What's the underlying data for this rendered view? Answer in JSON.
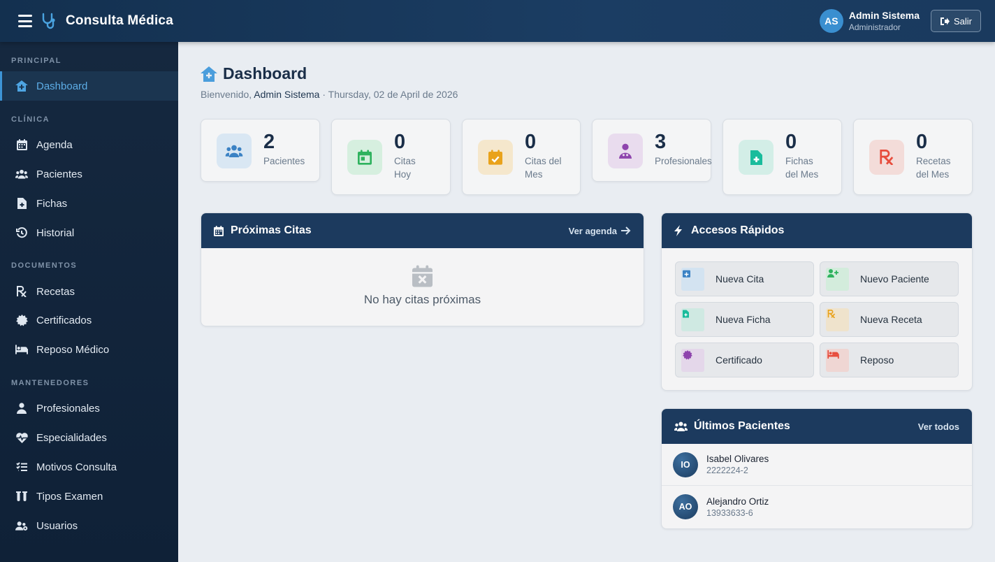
{
  "app": {
    "title": "Consulta Médica"
  },
  "user": {
    "initials": "AS",
    "name": "Admin Sistema",
    "role": "Administrador",
    "logout_label": "Salir"
  },
  "sidebar": {
    "sections": [
      {
        "title": "PRINCIPAL"
      },
      {
        "title": "CLÍNICA"
      },
      {
        "title": "DOCUMENTOS"
      },
      {
        "title": "MANTENEDORES"
      }
    ],
    "items": [
      {
        "label": "Dashboard",
        "icon": "home-medical-icon",
        "active": true
      },
      {
        "label": "Agenda",
        "icon": "calendar-icon"
      },
      {
        "label": "Pacientes",
        "icon": "users-icon"
      },
      {
        "label": "Fichas",
        "icon": "file-medical-icon"
      },
      {
        "label": "Historial",
        "icon": "history-icon"
      },
      {
        "label": "Recetas",
        "icon": "prescription-icon"
      },
      {
        "label": "Certificados",
        "icon": "certificate-icon"
      },
      {
        "label": "Reposo Médico",
        "icon": "bed-icon"
      },
      {
        "label": "Profesionales",
        "icon": "doctor-icon"
      },
      {
        "label": "Especialidades",
        "icon": "heartbeat-icon"
      },
      {
        "label": "Motivos Consulta",
        "icon": "list-check-icon"
      },
      {
        "label": "Tipos Examen",
        "icon": "vials-icon"
      },
      {
        "label": "Usuarios",
        "icon": "users-cog-icon"
      }
    ]
  },
  "page": {
    "title": "Dashboard",
    "welcome_prefix": "Bienvenido,",
    "welcome_user": "Admin Sistema",
    "welcome_date": "· Thursday, 02 de April de 2026"
  },
  "stats": [
    {
      "value": "2",
      "label_line1": "Pacientes",
      "label_line2": "",
      "color": "#3b82c4",
      "bg": "#d9e7f3"
    },
    {
      "value": "0",
      "label_line1": "Citas",
      "label_line2": "Hoy",
      "color": "#2fb25e",
      "bg": "#d6efdf"
    },
    {
      "value": "0",
      "label_line1": "Citas del",
      "label_line2": "Mes",
      "color": "#e9a21b",
      "bg": "#f5e7cc"
    },
    {
      "value": "3",
      "label_line1": "Profesionales",
      "label_line2": "",
      "color": "#8e44ad",
      "bg": "#e9dcee"
    },
    {
      "value": "0",
      "label_line1": "Fichas",
      "label_line2": "del Mes",
      "color": "#1abc9c",
      "bg": "#d3eee7"
    },
    {
      "value": "0",
      "label_line1": "Recetas",
      "label_line2": "del Mes",
      "color": "#e74c3c",
      "bg": "#f3dcd9"
    }
  ],
  "upcoming": {
    "title": "Próximas Citas",
    "link": "Ver agenda",
    "empty": "No hay citas próximas"
  },
  "quick": {
    "title": "Accesos Rápidos",
    "items": [
      {
        "label": "Nueva Cita",
        "color": "#3b82c4",
        "bg": "#d3e3f1"
      },
      {
        "label": "Nuevo Paciente",
        "color": "#2fb25e",
        "bg": "#d3ecdc"
      },
      {
        "label": "Nueva Ficha",
        "color": "#1abc9c",
        "bg": "#cfe9e2"
      },
      {
        "label": "Nueva Receta",
        "color": "#e9a21b",
        "bg": "#efe3cc"
      },
      {
        "label": "Certificado",
        "color": "#8e44ad",
        "bg": "#e4d7ea"
      },
      {
        "label": "Reposo",
        "color": "#e74c3c",
        "bg": "#efd6d3"
      }
    ]
  },
  "patients": {
    "title": "Últimos Pacientes",
    "link": "Ver todos",
    "rows": [
      {
        "initials": "IO",
        "name": "Isabel Olivares",
        "rut": "2222224-2"
      },
      {
        "initials": "AO",
        "name": "Alejandro Ortiz",
        "rut": "13933633-6"
      }
    ]
  }
}
